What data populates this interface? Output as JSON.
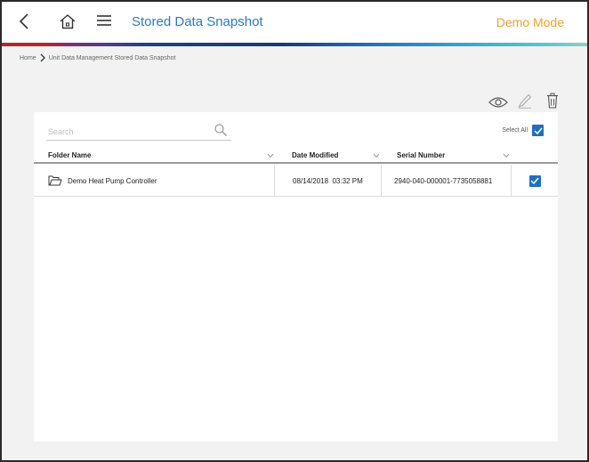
{
  "header": {
    "title": "Stored Data Snapshot",
    "mode_label": "Demo Mode",
    "back_icon": "chevron-left-icon",
    "home_icon": "home-icon",
    "menu_icon": "hamburger-menu-icon"
  },
  "breadcrumb": {
    "items": [
      "Home",
      "Unit Data Management",
      "Stored Data Snapshot"
    ],
    "separator_after_first": "chevron-right-icon"
  },
  "toolbar": {
    "icons": [
      "eye-icon",
      "pencil-icon",
      "trash-icon"
    ]
  },
  "search": {
    "placeholder": "Search",
    "value": ""
  },
  "select_all": {
    "label": "Select All",
    "checked": true
  },
  "table": {
    "columns": [
      "Folder Name",
      "Date Modified",
      "Serial Number"
    ],
    "rows": [
      {
        "folder_name": "Demo Heat Pump Controller",
        "date_modified": "08/14/2018  03:32 PM",
        "serial_number": "2940-040-000001-7735058881",
        "checked": true
      }
    ]
  },
  "colors": {
    "accent_blue": "#2a7bbf",
    "demo_mode_orange": "#f0a024",
    "checkbox_blue": "#1f6fc0"
  }
}
